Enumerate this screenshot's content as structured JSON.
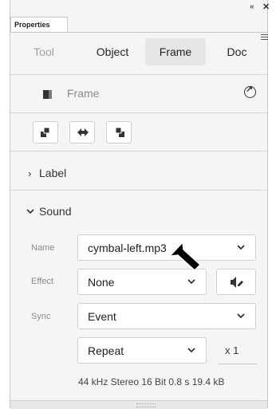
{
  "panel": {
    "title": "Properties"
  },
  "tabs": [
    {
      "label": "Tool",
      "state": "disabled"
    },
    {
      "label": "Object",
      "state": "normal"
    },
    {
      "label": "Frame",
      "state": "active"
    },
    {
      "label": "Doc",
      "state": "normal"
    }
  ],
  "frame_row": {
    "label": "Frame"
  },
  "sections": {
    "label": "Label",
    "sound": "Sound"
  },
  "sound": {
    "name_label": "Name",
    "name_value": "cymbal-left.mp3",
    "effect_label": "Effect",
    "effect_value": "None",
    "sync_label": "Sync",
    "sync_value": "Event",
    "repeat_value": "Repeat",
    "repeat_count": "x 1",
    "info": "44 kHz Stereo 16 Bit 0.8 s 19.4 kB"
  },
  "icons": {
    "collapse": "double-chevron-left-icon",
    "close": "close-icon",
    "menu": "hamburger-menu-icon",
    "frame": "frame-icon",
    "go_to": "circle-arrow-icon",
    "speaker": "speaker-edit-icon"
  },
  "colors": {
    "active_tab_bg": "#e6e6e6",
    "panel_bg": "#f5f5f5",
    "disabled_text": "#a0a0a0"
  }
}
